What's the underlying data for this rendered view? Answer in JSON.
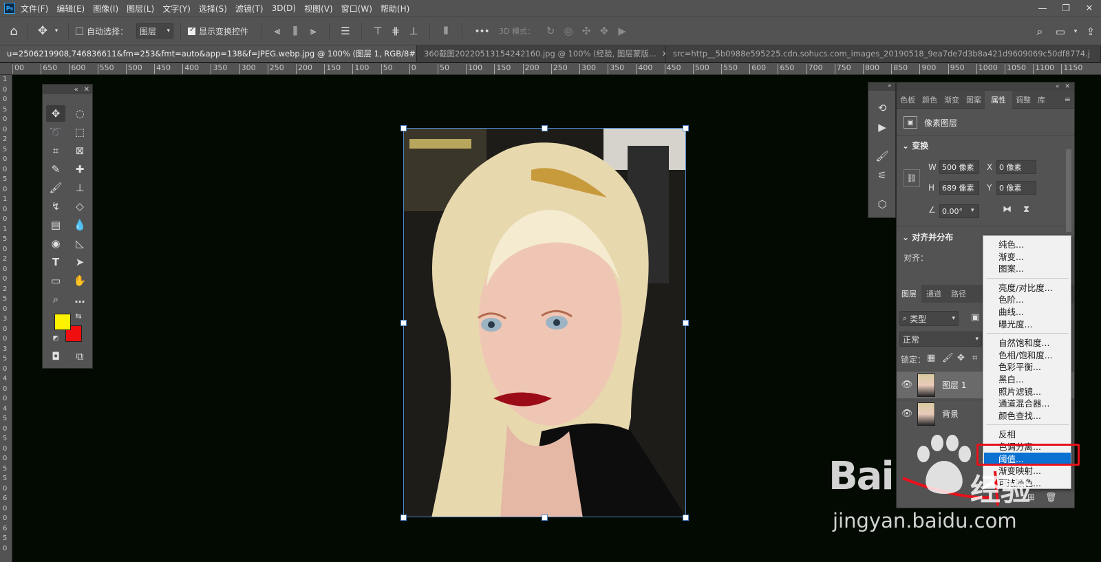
{
  "app": {
    "logo": "Ps"
  },
  "menubar": {
    "items": [
      "文件(F)",
      "编辑(E)",
      "图像(I)",
      "图层(L)",
      "文字(Y)",
      "选择(S)",
      "滤镜(T)",
      "3D(D)",
      "视图(V)",
      "窗口(W)",
      "帮助(H)"
    ],
    "window_controls": {
      "minimize": "—",
      "restore": "❐",
      "close": "✕"
    }
  },
  "options": {
    "auto_select_label": "自动选择：",
    "auto_select_target": "图层",
    "show_transform_label": "显示变换控件",
    "mode_3d_label": "3D 模式：",
    "more": "•••"
  },
  "tabs": [
    {
      "label": "u=2506219908,746836611&fm=253&fmt=auto&app=138&f=JPEG.webp.jpg @ 100% (图层 1, RGB/8#) *",
      "close": "✕"
    },
    {
      "label": "360截图20220513154242160.jpg @ 100% (经验, 图层蒙版...",
      "close": "✕"
    },
    {
      "label": "src=http__5b0988e595225.cdn.sohucs.com_images_20190518_9ea7de7d3b8a421d9609069c50df8774.j",
      "close": ""
    }
  ],
  "ruler": {
    "h_ticks": [
      "00",
      "650",
      "600",
      "550",
      "500",
      "450",
      "400",
      "350",
      "300",
      "250",
      "200",
      "150",
      "100",
      "50",
      "0",
      "50",
      "100",
      "150",
      "200",
      "250",
      "300",
      "350",
      "400",
      "450",
      "500",
      "550",
      "600",
      "650",
      "700",
      "750",
      "800",
      "850",
      "900",
      "950",
      "1000",
      "1050",
      "1100",
      "1150"
    ],
    "v_digits": [
      "1",
      "0",
      "0",
      "5",
      "0",
      "0",
      "2",
      "5",
      "0",
      "0",
      "5",
      "0",
      "1",
      "0",
      "0",
      "1",
      "5",
      "0",
      "2",
      "0",
      "0",
      "2",
      "5",
      "0",
      "3",
      "0",
      "0",
      "3",
      "5",
      "0",
      "4",
      "0",
      "0",
      "4",
      "5",
      "0",
      "5",
      "0",
      "0",
      "5",
      "5",
      "0",
      "6",
      "0",
      "0",
      "6",
      "5",
      "0"
    ]
  },
  "properties": {
    "tabs": [
      "色板",
      "颜色",
      "渐变",
      "图案",
      "属性",
      "调整",
      "库"
    ],
    "active_tab": "属性",
    "layer_kind": "像素图层",
    "transform_title": "变换",
    "w_label": "W",
    "w_value": "500 像素",
    "x_label": "X",
    "x_value": "0 像素",
    "h_label": "H",
    "h_value": "689 像素",
    "y_label": "Y",
    "y_value": "0 像素",
    "angle_value": "0.00°",
    "align_title": "对齐并分布",
    "align_label": "对齐："
  },
  "layers": {
    "tabs": [
      "图层",
      "通道",
      "路径"
    ],
    "filter_kind": "类型",
    "blend_mode": "正常",
    "lock_label": "锁定：",
    "items": [
      {
        "name": "图层 1",
        "selected": true
      },
      {
        "name": "背景",
        "selected": false
      }
    ]
  },
  "context_menu": {
    "groups": [
      [
        "纯色...",
        "渐变...",
        "图案..."
      ],
      [
        "亮度/对比度...",
        "色阶...",
        "曲线...",
        "曝光度..."
      ],
      [
        "自然饱和度...",
        "色相/饱和度...",
        "色彩平衡...",
        "黑白...",
        "照片滤镜...",
        "通道混合器...",
        "颜色查找..."
      ],
      [
        "反相",
        "色调分离...",
        "阈值...",
        "渐变映射...",
        "可选颜色..."
      ]
    ],
    "highlighted": "阈值..."
  },
  "watermark": {
    "brand_left": "Bai",
    "brand_right": "经验",
    "url": "jingyan.baidu.com"
  },
  "colors": {
    "foreground": "#fff200",
    "background": "#ef0f0f",
    "highlight": "#0a71d3",
    "annotation": "#e8101a"
  }
}
